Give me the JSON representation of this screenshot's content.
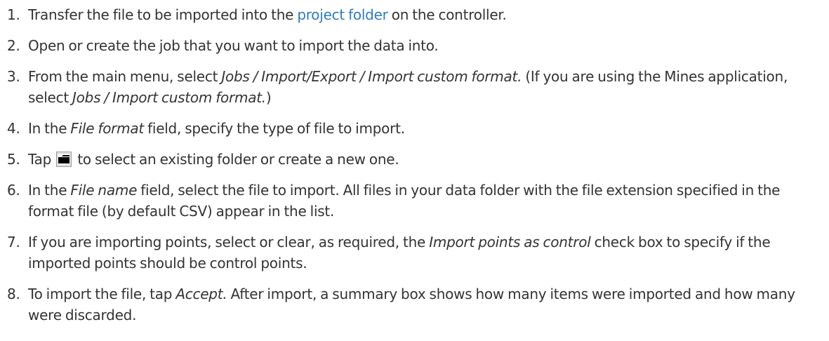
{
  "steps": [
    {
      "num": "1.",
      "pre": "Transfer the file to be imported into the ",
      "link": "project folder",
      "post": " on the controller."
    },
    {
      "num": "2.",
      "text": "Open or create the job that you want to import the data into."
    },
    {
      "num": "3.",
      "a": "From the main menu, select ",
      "b": "Jobs / Import/Export / Import custom format.",
      "c": " (If you are using the Mines application, select ",
      "d": "Jobs / Import custom format.",
      "e": ")"
    },
    {
      "num": "4.",
      "a": "In the ",
      "b": "File format",
      "c": " field, specify the type of file to import."
    },
    {
      "num": "5.",
      "a": "Tap ",
      "icon": "folder-browse-icon",
      "c": " to select an existing folder or create a new one."
    },
    {
      "num": "6.",
      "a": "In the ",
      "b": "File name",
      "c": " field, select the file to import. All files in your data folder with the file extension specified in the format file (by default CSV) appear in the list."
    },
    {
      "num": "7.",
      "a": "If you are importing points, select or clear, as required, the ",
      "b": "Import points as control",
      "c": " check box to specify if the imported points should be control points."
    },
    {
      "num": "8.",
      "a": "To import the file, tap ",
      "b": "Accept.",
      "c": " After import, a summary box shows how many items were imported and how many were discarded."
    }
  ],
  "colors": {
    "text": "#333333",
    "link": "#2e7bbf"
  }
}
